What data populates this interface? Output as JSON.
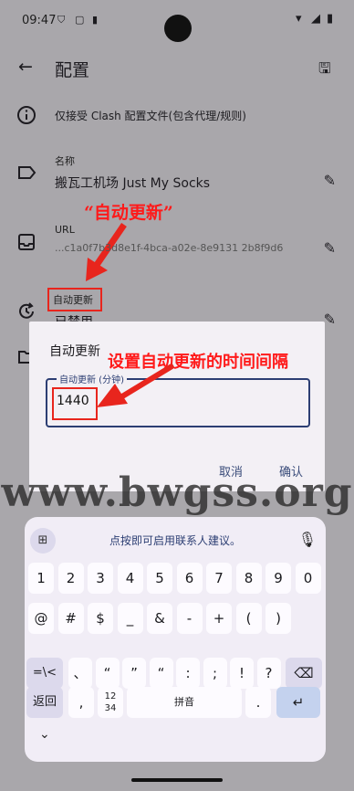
{
  "status": {
    "time": "09:47"
  },
  "toolbar": {
    "title": "配置"
  },
  "info": {
    "text": "仅接受 Clash 配置文件(包含代理/规则)"
  },
  "name_row": {
    "label": "名称",
    "value": "搬瓦工机场 Just My Socks"
  },
  "annotation_top": "“自动更新”",
  "url_row": {
    "label": "URL",
    "value": "...c1a0f7b3d8e1f-4bca-a02e-8e9131 2b8f9d6"
  },
  "autoupdate_row": {
    "label": "自动更新",
    "value": "已禁用"
  },
  "dialog": {
    "title": "自动更新",
    "field_label": "自动更新 (分钟)",
    "field_value": "1440",
    "cancel": "取消",
    "confirm": "确认"
  },
  "annotation_right": "设置自动更新的时间间隔",
  "watermark": "www.bwgss.org",
  "keyboard": {
    "suggestion": "点按即可启用联系人建议。",
    "row1": [
      "1",
      "2",
      "3",
      "4",
      "5",
      "6",
      "7",
      "8",
      "9",
      "0"
    ],
    "row2": [
      "@",
      "#",
      "$",
      "_",
      "&",
      "-",
      "+",
      "(",
      ")"
    ],
    "row3": [
      "=\\<",
      "、",
      "“",
      "”",
      "“",
      ":",
      ";",
      "!",
      "?"
    ],
    "back": "返回",
    "comma": ",",
    "numpad": "12 34",
    "space": "拼音",
    "period": "."
  },
  "colors": {
    "accent": "#2c3e73",
    "annotation": "#e8251d"
  }
}
